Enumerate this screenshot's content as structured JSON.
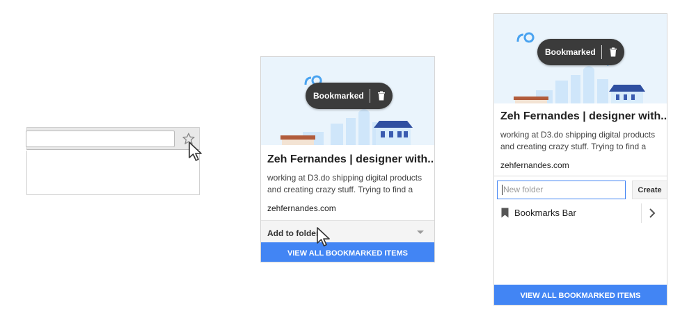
{
  "panel2": {
    "pill_label": "Bookmarked",
    "title": "Zeh Fernandes | designer with...",
    "description": "working at D3.do shipping digital products and creating crazy stuff. Trying to find a",
    "domain": "zehfernandes.com",
    "folder_label": "Add to folder",
    "cta": "VIEW ALL BOOKMARKED ITEMS"
  },
  "panel3": {
    "pill_label": "Bookmarked",
    "title": "Zeh Fernandes | designer with...",
    "description": "working at D3.do shipping digital products and creating crazy stuff. Trying to find a",
    "domain": "zehfernandes.com",
    "new_folder_placeholder": "New folder",
    "create_label": "Create",
    "bookmarks_bar_label": "Bookmarks Bar",
    "cta": "VIEW ALL BOOKMARKED ITEMS"
  },
  "icons": {
    "star": "star-icon",
    "cursor": "cursor-arrow-icon",
    "trash": "trash-icon",
    "bookmark": "bookmark-icon",
    "chevron": "chevron-right-icon",
    "caret": "caret-down-icon"
  },
  "colors": {
    "accent": "#4285f4",
    "pill": "#3b3b3b",
    "hero_bg": "#eaf4fc"
  }
}
